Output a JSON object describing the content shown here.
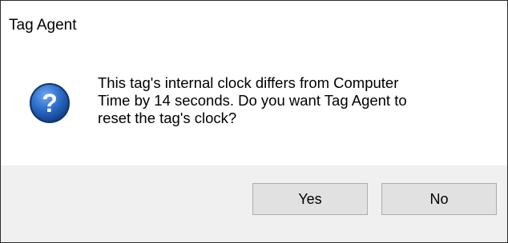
{
  "dialog": {
    "title": "Tag Agent",
    "icon": "question-icon",
    "message_lines": [
      "This tag's internal clock differs from Computer",
      "Time by 14 seconds. Do you want Tag Agent to",
      "reset the tag's clock?"
    ],
    "buttons": {
      "yes_label": "Yes",
      "no_label": "No"
    }
  },
  "colors": {
    "icon_blue": "#1d5fb8",
    "footer_bg": "#f0f0f0",
    "button_bg": "#e1e1e1",
    "button_border": "#adadad"
  }
}
